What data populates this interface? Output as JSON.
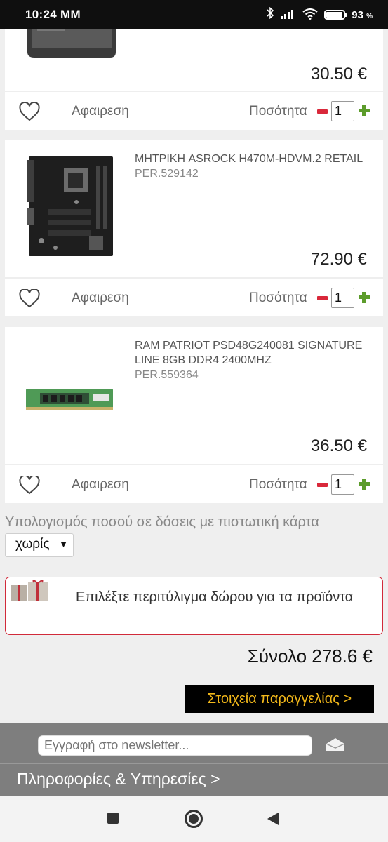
{
  "status_bar": {
    "time": "10:24 MM",
    "battery_percent": "93",
    "battery_suffix": "%",
    "icons": [
      "bluetooth-icon",
      "signal-icon",
      "wifi-icon",
      "battery-icon"
    ]
  },
  "cart": {
    "items": [
      {
        "name": "",
        "code": "",
        "price": "30.50 €",
        "remove_label": "Αφαιρεση",
        "quantity_label": "Ποσότητα",
        "quantity": "1"
      },
      {
        "name": "ΜΗΤΡΙΚΗ ASROCK H470M-HDVM.2 RETAIL",
        "code": "PER.529142",
        "price": "72.90 €",
        "remove_label": "Αφαιρεση",
        "quantity_label": "Ποσότητα",
        "quantity": "1"
      },
      {
        "name": "RAM PATRIOT PSD48G240081 SIGNATURE LINE 8GB DDR4 2400MHZ",
        "code": "PER.559364",
        "price": "36.50 €",
        "remove_label": "Αφαιρεση",
        "quantity_label": "Ποσότητα",
        "quantity": "1"
      }
    ]
  },
  "installments": {
    "label": "Υπολογισμός ποσού σε δόσεις με πιστωτική κάρτα",
    "selected": "χωρίς"
  },
  "gift_wrap": {
    "label": "Επιλέξτε περιτύλιγμα δώρου για τα προϊόντα"
  },
  "total": {
    "label": "Σύνολο 278.6 €"
  },
  "checkout": {
    "label": "Στοιχεία παραγγελίας >"
  },
  "footer": {
    "newsletter_placeholder": "Εγγραφή στο newsletter...",
    "info_link": "Πληροφορίες & Υπηρεσίες >"
  },
  "colors": {
    "accent_red": "#d12a3a",
    "plus_green": "#5c9c2b",
    "checkout_text": "#f2b81a",
    "footer_bg": "#7e7e7e"
  }
}
